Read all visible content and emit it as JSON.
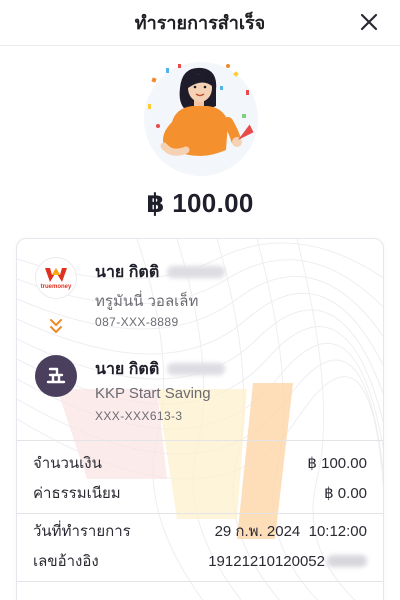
{
  "header": {
    "title": "ทำรายการสำเร็จ",
    "close_icon": "close-icon"
  },
  "hero": {
    "illustration": "celebration-illustration"
  },
  "transaction": {
    "amount": "฿ 100.00",
    "sender": {
      "name": "นาย กิตติ",
      "provider": "ทรูมันนี่ วอลเล็ท",
      "account": "087-XXX-8889",
      "logo_text": "truemoney",
      "logo_icon": "truemoney-logo-icon"
    },
    "direction_icon": "double-chevron-down-icon",
    "receiver": {
      "name": "นาย กิตติ",
      "provider": "KKP Start Saving",
      "account": "XXX-XXX613-3",
      "logo_icon": "kkp-logo-icon"
    },
    "details": {
      "amount_label": "จำนวนเงิน",
      "amount_value": "฿ 100.00",
      "fee_label": "ค่าธรรมเนียม",
      "fee_value": "฿ 0.00",
      "date_label": "วันที่ทำรายการ",
      "date_value": "29 ก.พ. 2024  10:12:00",
      "ref_label": "เลขอ้างอิง",
      "ref_value": "19121210120052"
    }
  },
  "colors": {
    "accent_orange": "#f08a2a",
    "truemoney_red": "#e0301e",
    "kkp_purple": "#4b3f5e",
    "text_primary": "#1f1f2b",
    "text_secondary": "#6b6b73"
  }
}
